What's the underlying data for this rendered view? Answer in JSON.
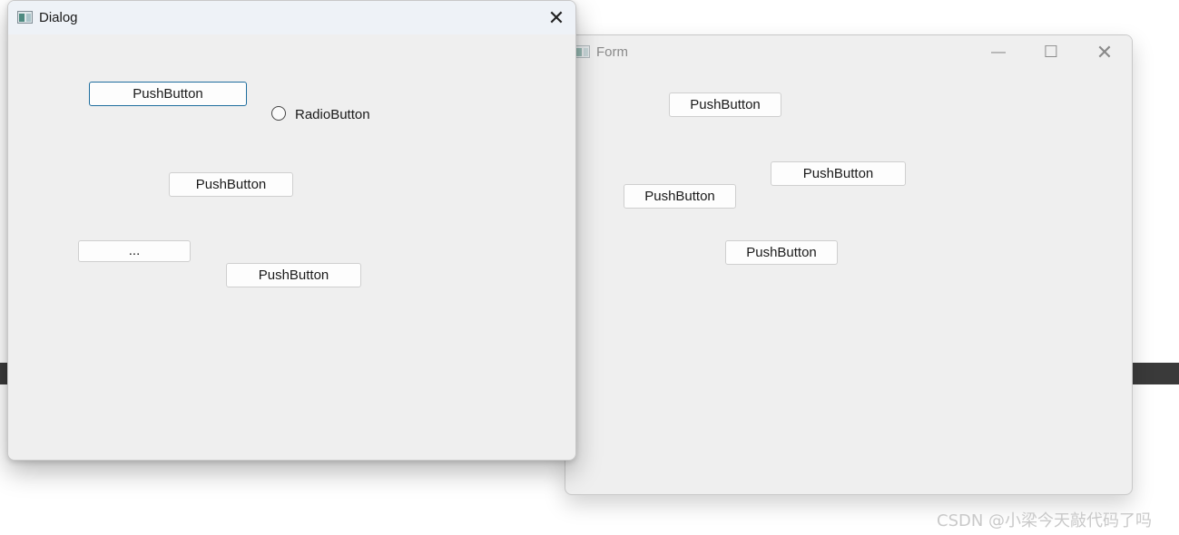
{
  "dialog": {
    "title": "Dialog",
    "close_glyph": "✕",
    "buttons": {
      "push1": "PushButton",
      "push2": "PushButton",
      "tool": "...",
      "push3": "PushButton"
    },
    "radio_label": "RadioButton"
  },
  "form": {
    "title": "Form",
    "minimize_glyph": "—",
    "maximize_glyph": "☐",
    "close_glyph": "✕",
    "buttons": {
      "push1": "PushButton",
      "push2": "PushButton",
      "push3": "PushButton",
      "push4": "PushButton"
    }
  },
  "watermark": "CSDN @小梁今天敲代码了吗",
  "icons": [
    "app-window-icon",
    "close-icon",
    "minimize-icon",
    "maximize-icon",
    "radio-icon"
  ]
}
